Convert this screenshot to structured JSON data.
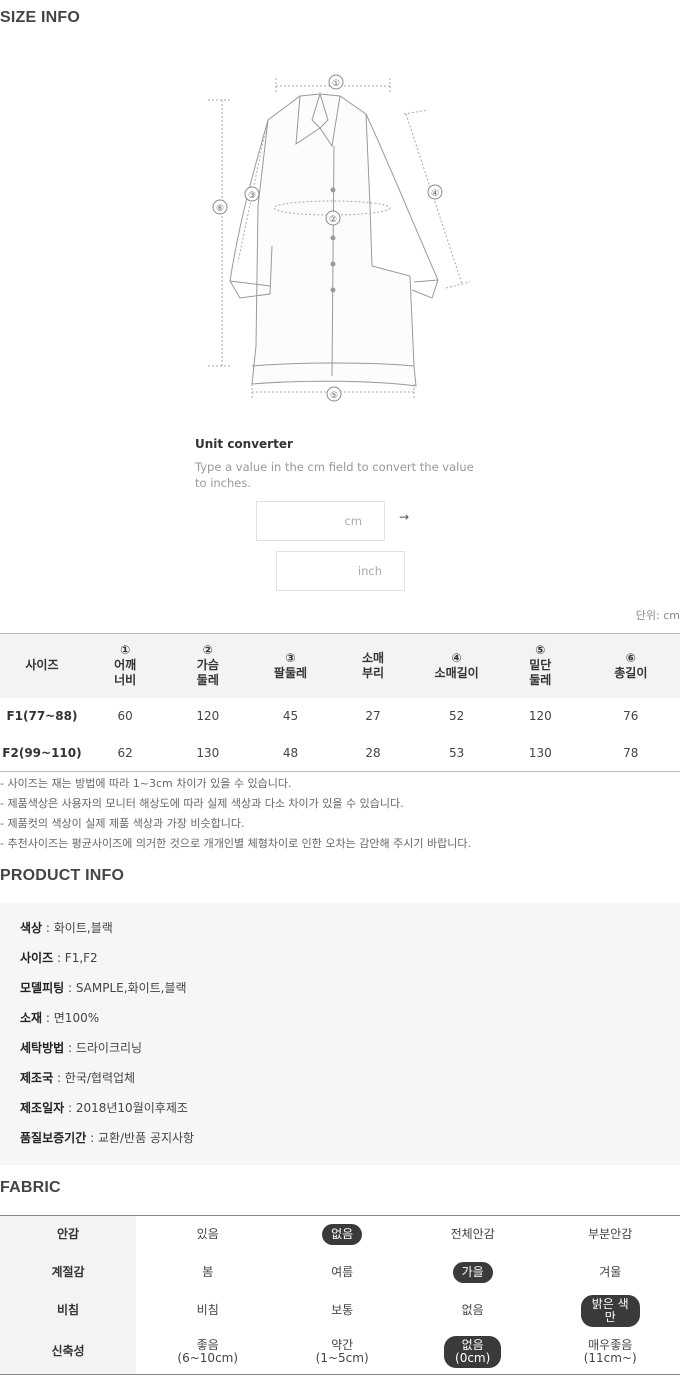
{
  "size_info": {
    "title": "SIZE INFO",
    "diagram_markers": [
      "①",
      "②",
      "③",
      "④",
      "⑤",
      "⑥"
    ],
    "converter": {
      "title": "Unit converter",
      "description": "Type a value in the cm field to convert the value to inches.",
      "cm_placeholder": "cm",
      "inch_placeholder": "inch",
      "arrow": "→"
    },
    "unit_note": "단위: cm"
  },
  "size_table": {
    "headers": [
      {
        "num": "",
        "label": "사이즈"
      },
      {
        "num": "①",
        "label": "어깨\n너비"
      },
      {
        "num": "②",
        "label": "가슴\n둘레"
      },
      {
        "num": "③",
        "label": "팔둘레"
      },
      {
        "num": "",
        "label": "소매\n부리"
      },
      {
        "num": "④",
        "label": "소매길이"
      },
      {
        "num": "⑤",
        "label": "밑단\n둘레"
      },
      {
        "num": "⑥",
        "label": "총길이"
      }
    ],
    "rows": [
      [
        "F1(77~88)",
        "60",
        "120",
        "45",
        "27",
        "52",
        "120",
        "76"
      ],
      [
        "F2(99~110)",
        "62",
        "130",
        "48",
        "28",
        "53",
        "130",
        "78"
      ]
    ]
  },
  "notes": [
    "- 사이즈는 재는 방법에 따라 1~3cm 차이가 있을 수 있습니다.",
    "- 제품색상은 사용자의 모니터 해상도에 따라 실제 색상과 다소 차이가 있을 수 있습니다.",
    "- 제품컷의 색상이 실제 제품 색상과 가장 비슷합니다.",
    "- 추천사이즈는 평균사이즈에 의거한 것으로 개개인별 체형차이로 인한 오차는 감안해 주시기 바랍니다."
  ],
  "product_info": {
    "title": "PRODUCT INFO",
    "rows": [
      {
        "key": "색상",
        "value": " : 화이트,블랙"
      },
      {
        "key": "사이즈",
        "value": " : F1,F2"
      },
      {
        "key": "모델피팅",
        "value": " : SAMPLE,화이트,블랙"
      },
      {
        "key": "소재",
        "value": " : 면100%"
      },
      {
        "key": "세탁방법",
        "value": " : 드라이크리닝"
      },
      {
        "key": "제조국",
        "value": " : 한국/협력업체"
      },
      {
        "key": "제조일자",
        "value": " : 2018년10월이후제조"
      },
      {
        "key": "품질보증기간",
        "value": " : 교환/반품 공지사항"
      }
    ]
  },
  "fabric": {
    "title": "FABRIC",
    "rows": [
      {
        "label": "안감",
        "options": [
          "있음",
          "없음",
          "전체안감",
          "부분안감"
        ],
        "selected": 1
      },
      {
        "label": "계절감",
        "options": [
          "봄",
          "여름",
          "가을",
          "겨울"
        ],
        "selected": 2
      },
      {
        "label": "비침",
        "options": [
          "비침",
          "보통",
          "없음",
          "밝은 색\n만"
        ],
        "selected": 3
      },
      {
        "label": "신축성",
        "options": [
          "좋음\n(6~10cm)",
          "약간\n(1~5cm)",
          "없음\n(0cm)",
          "매우좋음\n(11cm~)"
        ],
        "selected": 2
      }
    ]
  },
  "colors": {
    "pill": "#3a3a3a",
    "header_bg": "#f3f3f3",
    "info_bg": "#f6f6f6",
    "title": "#444444"
  }
}
